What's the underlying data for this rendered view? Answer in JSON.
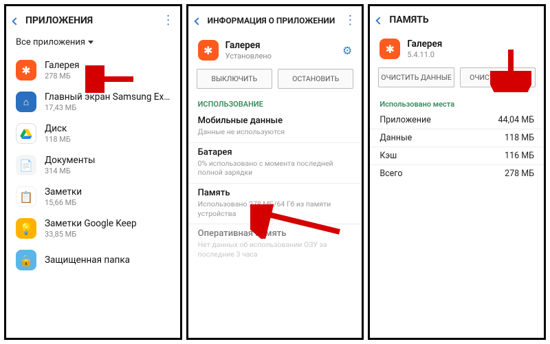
{
  "p1": {
    "title": "ПРИЛОЖЕНИЯ",
    "filter": "Все приложения",
    "apps": [
      {
        "name": "Галерея",
        "size": "278 МБ"
      },
      {
        "name": "Главный экран Samsung Experie..",
        "size": "17,43 МБ"
      },
      {
        "name": "Диск",
        "size": "118 МБ"
      },
      {
        "name": "Документы",
        "size": "314 МБ"
      },
      {
        "name": "Заметки",
        "size": "15,66 МБ"
      },
      {
        "name": "Заметки Google Keep",
        "size": "33,85 МБ"
      },
      {
        "name": "Защищенная папка",
        "size": ""
      }
    ]
  },
  "p2": {
    "title": "ИНФОРМАЦИЯ О ПРИЛОЖЕНИИ",
    "app_name": "Галерея",
    "app_status": "Установлено",
    "btn_disable": "ВЫКЛЮЧИТЬ",
    "btn_stop": "ОСТАНОВИТЬ",
    "sec_usage": "ИСПОЛЬЗОВАНИЕ",
    "mobile_t": "Мобильные данные",
    "mobile_s": "Данные не используются",
    "battery_t": "Батарея",
    "battery_s": "0% использовано с момента последней полной зарядки",
    "memory_t": "Память",
    "memory_s": "Использовано 278 МБ/64 Гб из памяти устройства",
    "ram_t": "Оперативная память",
    "ram_s": "Нет данных об использовании ОЗУ за последние 3 часа"
  },
  "p3": {
    "title": "ПАМЯТЬ",
    "app_name": "Галерея",
    "app_ver": "5.4.11.0",
    "btn_clear_data": "ОЧИСТИТЬ ДАННЫЕ",
    "btn_clear_cache": "ОЧИСТИТЬ КЭШ",
    "sec_used": "Использовано места",
    "rows": [
      {
        "k": "Приложение",
        "v": "44,04 МБ"
      },
      {
        "k": "Данные",
        "v": "118 МБ"
      },
      {
        "k": "Кэш",
        "v": "116 МБ"
      },
      {
        "k": "Всего",
        "v": "278 МБ"
      }
    ]
  }
}
